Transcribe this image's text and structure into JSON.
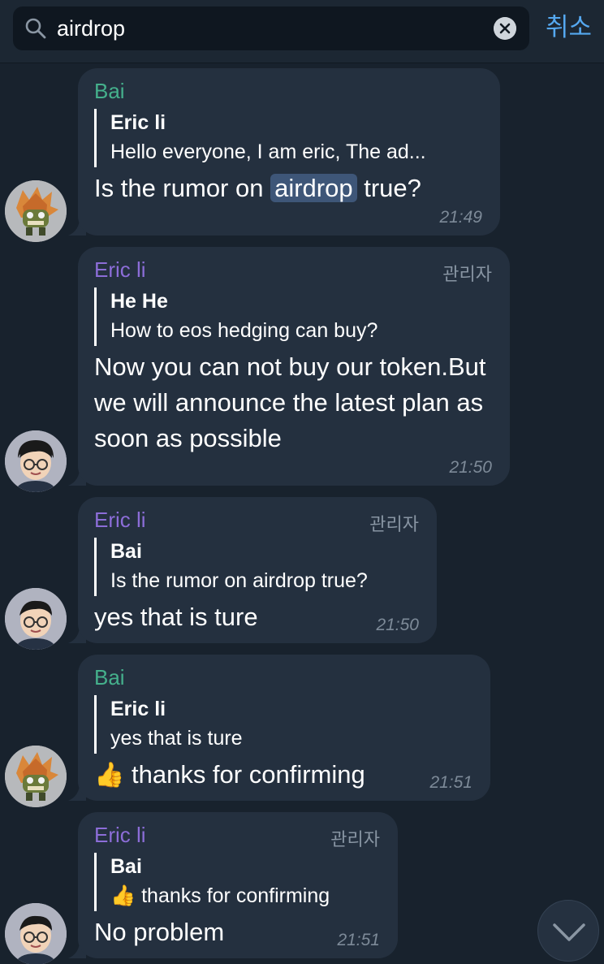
{
  "search": {
    "query": "airdrop",
    "cancel_label": "취소"
  },
  "messages": [
    {
      "sender": "Bai",
      "reply_name": "Eric li",
      "reply_text": "Hello everyone, I am eric, The ad...",
      "body_before": "Is the rumor on ",
      "body_highlight": "airdrop",
      "body_after": " true?",
      "time": "21:49"
    },
    {
      "sender": "Eric li",
      "role": "관리자",
      "reply_name": "He He",
      "reply_text": "How to eos hedging can buy?",
      "body": "Now you can not buy our token.But we will announce the latest plan as soon as possible",
      "time": "21:50"
    },
    {
      "sender": "Eric li",
      "role": "관리자",
      "reply_name": "Bai",
      "reply_text": "Is the rumor on airdrop true?",
      "body": "yes that is ture",
      "time": "21:50"
    },
    {
      "sender": "Bai",
      "reply_name": "Eric li",
      "reply_text": "yes that is ture",
      "body_emoji": "👍",
      "body": "thanks for confirming",
      "time": "21:51"
    },
    {
      "sender": "Eric li",
      "role": "관리자",
      "reply_name": "Bai",
      "reply_emoji": "👍",
      "reply_text": "thanks for confirming",
      "body": "No problem",
      "time": "21:51"
    }
  ]
}
